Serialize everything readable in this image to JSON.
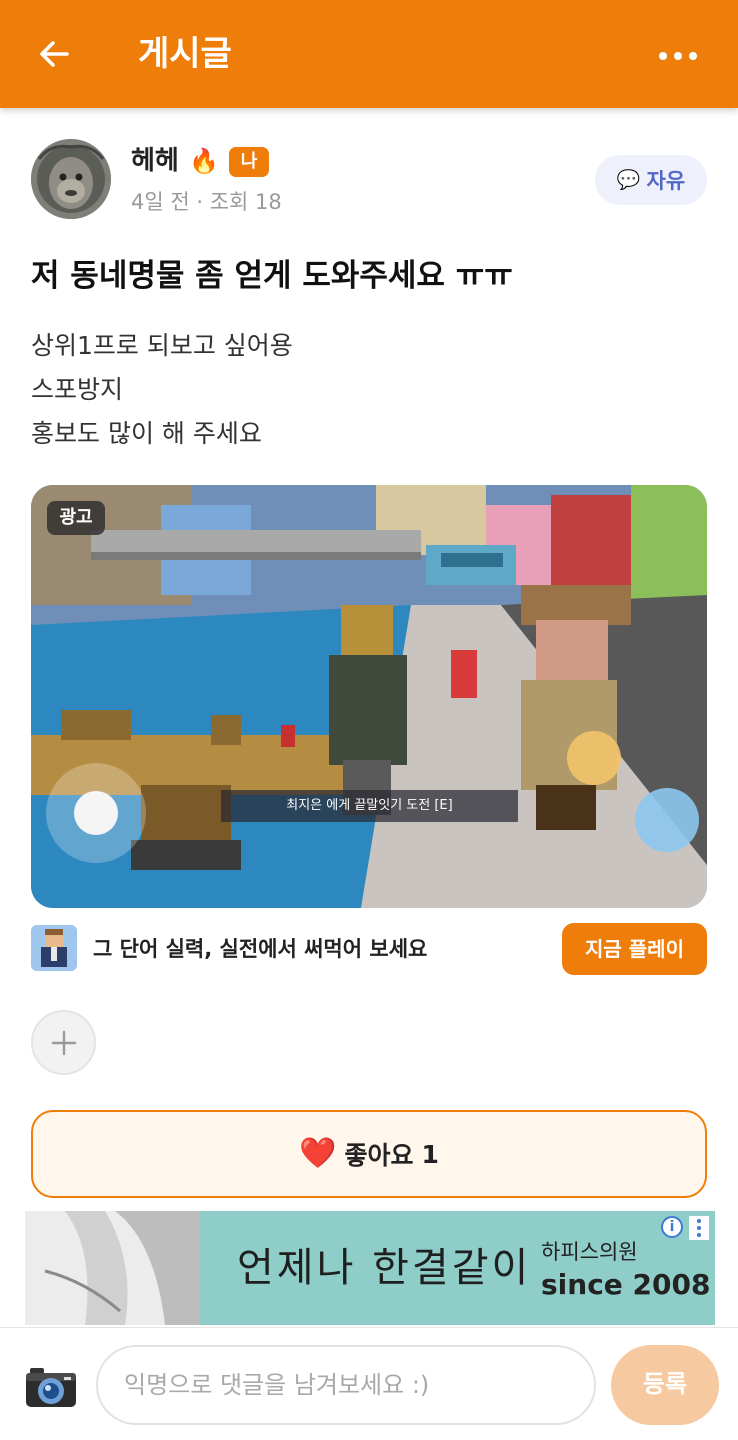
{
  "appbar": {
    "title": "게시글",
    "back_icon": "arrow-left-icon",
    "more_icon": "more-horizontal-icon",
    "color": "#ef7d0a"
  },
  "post": {
    "author": "헤헤",
    "fire_icon": "🔥",
    "level_badge": "나",
    "meta": "4일 전 · 조회 18",
    "category": "자유",
    "category_icon": "💬",
    "title": "저 동네명물 좀 얻게 도와주세요 ㅠㅠ",
    "body_lines": [
      "상위1프로 되보고 싶어용",
      "스포방지",
      "홍보도 많이 해 주세요"
    ]
  },
  "ad": {
    "tag": "광고",
    "game_prompt": "최지은 에게 끝말잇기 도전 [E]",
    "text": "그 단어 실력, 실전에서 써먹어 보세요",
    "cta": "지금 플레이"
  },
  "like": {
    "icon": "❤️",
    "label": "좋아요",
    "count": "1"
  },
  "banner": {
    "copy": "언제나 한결같이",
    "brand": "하피스의원",
    "since": "since 2008"
  },
  "comment": {
    "placeholder": "익명으로 댓글을 남겨보세요 :)",
    "submit": "등록"
  }
}
